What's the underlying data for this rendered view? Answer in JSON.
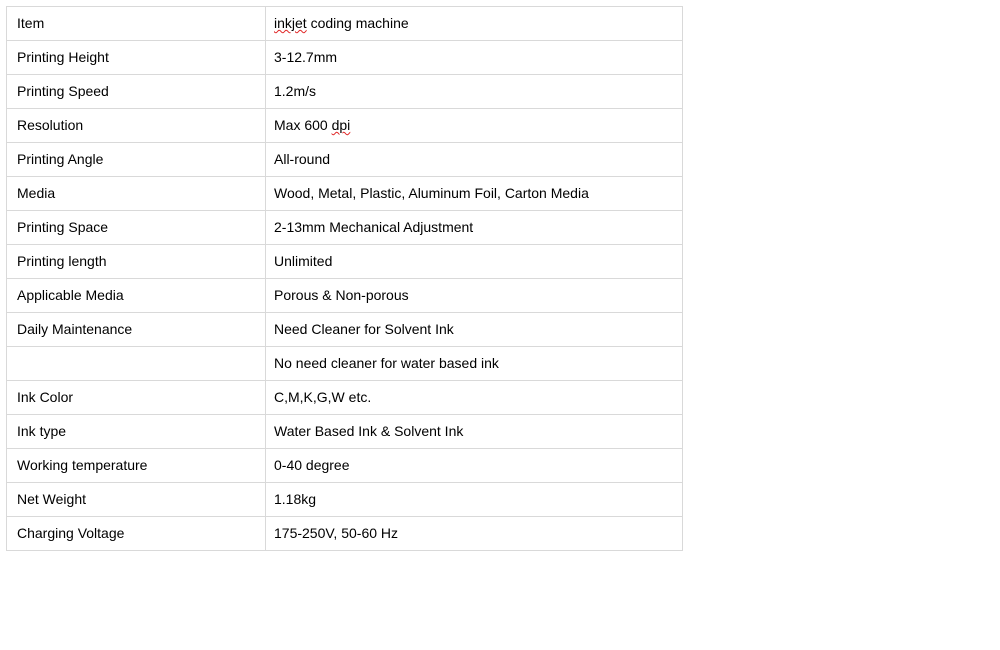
{
  "rows": [
    {
      "label": " Item",
      "value": "inkjet coding machine",
      "squiggle_word": "inkjet"
    },
    {
      "label": "Printing Height",
      "value": "3-12.7mm"
    },
    {
      "label": "Printing Speed",
      "value": "1.2m/s"
    },
    {
      "label": "Resolution",
      "value": "Max 600 dpi",
      "squiggle_word": "dpi"
    },
    {
      "label": "Printing Angle",
      "value": "All-round"
    },
    {
      "label": "Media",
      "value": "Wood, Metal, Plastic, Aluminum Foil, Carton Media"
    },
    {
      "label": "Printing Space",
      "value": "2-13mm Mechanical Adjustment"
    },
    {
      "label": "Printing length",
      "value": "Unlimited"
    },
    {
      "label": "Applicable Media",
      "value": "Porous & Non-porous"
    },
    {
      "label": "Daily Maintenance",
      "value": "Need Cleaner for Solvent Ink"
    },
    {
      "label": "",
      "value": "No need cleaner for water based ink"
    },
    {
      "label": "Ink Color",
      "value": "C,M,K,G,W etc."
    },
    {
      "label": "Ink type",
      "value": "Water Based Ink & Solvent Ink"
    },
    {
      "label": "Working temperature",
      "value": "0-40 degree"
    },
    {
      "label": "Net Weight",
      "value": "1.18kg"
    },
    {
      "label": "Charging Voltage",
      "value": "175-250V, 50-60 Hz"
    }
  ]
}
